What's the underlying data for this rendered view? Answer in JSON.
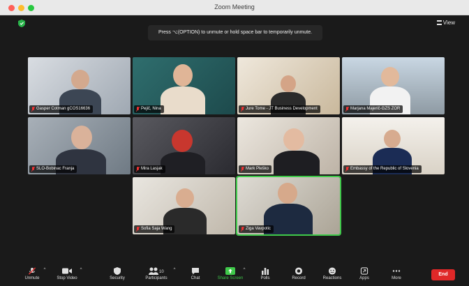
{
  "window": {
    "title": "Zoom Meeting"
  },
  "banner": {
    "text": "Press ⌥(OPTION) to unmute or hold space bar to temporarily unmute."
  },
  "view": {
    "label": "View"
  },
  "participants": [
    {
      "name": "Gasper Cotman gCOS16636"
    },
    {
      "name": "Pejič, Nina"
    },
    {
      "name": "Jure Tome - JT Business Development"
    },
    {
      "name": "Marjana Majerič-GZS ZOR"
    },
    {
      "name": "SLO-Bobinac Franja"
    },
    {
      "name": "Mira Lasjak"
    },
    {
      "name": "Mark Pleško"
    },
    {
      "name": "Embassy of the Republic of Slovenia"
    },
    {
      "name": "Sofia Saja Wang"
    },
    {
      "name": "Ziga Vavpotic"
    }
  ],
  "toolbar": {
    "unmute": "Unmute",
    "stop_video": "Stop Video",
    "security": "Security",
    "participants": "Participants",
    "participants_count": "10",
    "chat": "Chat",
    "share_screen": "Share Screen",
    "polls": "Polls",
    "record": "Record",
    "reactions": "Reactions",
    "apps": "Apps",
    "more": "More",
    "end": "End"
  },
  "colors": {
    "share_green": "#3fc94a",
    "end_red": "#e02828",
    "active_border": "#3fc94a"
  }
}
